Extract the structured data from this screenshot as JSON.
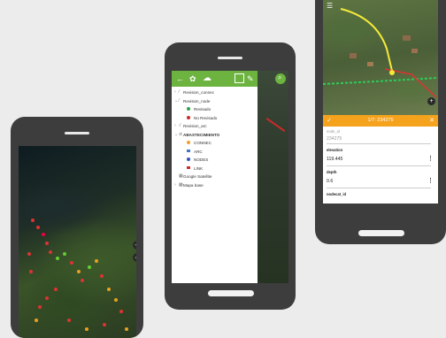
{
  "colors": {
    "toolbar_green": "#6cb33f",
    "form_orange": "#f5a21d",
    "revisado": "#2ea34a",
    "no_revisado": "#cf2a2a",
    "connec": "#f0a030",
    "arc": "#3f78c7",
    "nodes": "#2f55b8",
    "link": "#cc2a2a"
  },
  "phone1": {
    "zoom_in_icon": "+",
    "zoom_out_icon": "−",
    "map_points_note": "satellite map with red and orange/green network points"
  },
  "phone2": {
    "toolbar_icons": [
      "back-arrow-icon",
      "gear-icon",
      "cloud-icon",
      "layers-toggle-icon",
      "edit-pencil-icon"
    ],
    "layers": [
      {
        "label": "Revision_connec",
        "level": 0,
        "kind": "group"
      },
      {
        "label": "Revision_node",
        "level": 0,
        "kind": "group"
      },
      {
        "label": "Revisado",
        "level": 1,
        "kind": "dot",
        "color": "#2ea34a"
      },
      {
        "label": "No Revisado",
        "level": 1,
        "kind": "dot",
        "color": "#cf2a2a"
      },
      {
        "label": "Revision_arc",
        "level": 0,
        "kind": "group"
      },
      {
        "label": "ABASTECIMIENTO",
        "level": 0,
        "kind": "group-bold"
      },
      {
        "label": "CONNEC",
        "level": 1,
        "kind": "dot",
        "color": "#f0a030"
      },
      {
        "label": "ARC",
        "level": 1,
        "kind": "line",
        "color": "#3f78c7"
      },
      {
        "label": "NODES",
        "level": 1,
        "kind": "dot",
        "color": "#2f55b8"
      },
      {
        "label": "LINK",
        "level": 1,
        "kind": "line",
        "color": "#cc2a2a"
      },
      {
        "label": "Google Satellite",
        "level": 0,
        "kind": "raster"
      },
      {
        "label": "Mapa base",
        "level": 0,
        "kind": "raster"
      }
    ]
  },
  "phone3": {
    "feature_counter": "1/7: 234275",
    "fields": [
      {
        "label": "node_id",
        "value": "234275",
        "readonly": true
      },
      {
        "label": "elevation",
        "value": "119.445",
        "readonly": false
      },
      {
        "label": "depth",
        "value": "0.6",
        "readonly": false
      },
      {
        "label": "nodecat_id",
        "value": "",
        "readonly": false
      }
    ]
  }
}
